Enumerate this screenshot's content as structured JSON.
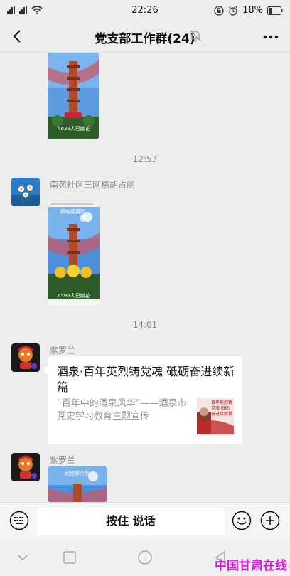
{
  "status_bar": {
    "time": "22:26",
    "battery": "18%",
    "network_left": "4G",
    "network_right": "4G"
  },
  "header": {
    "title": "党支部工作群(24)"
  },
  "messages": {
    "timestamp_1": "12:53",
    "timestamp_2": "14:01",
    "sender_1": "南苑社区三网格胡占丽",
    "sender_2": "紫罗兰",
    "sender_3": "紫罗兰",
    "poster_1_banner": "",
    "poster_2_banner": "网络祭英烈",
    "poster_3_banner": "网络祭英烈",
    "poster_count_1": "4639人已献花",
    "poster_count_2": "6599人已献花",
    "card": {
      "title": "酒泉·百年英烈铸党魂 砥砺奋进续新篇",
      "description": "“百年中的酒泉风华”——酒泉市党史学习教育主题宣传",
      "thumb_text": "百年英烈铸党魂 砥砺奋进续新篇"
    }
  },
  "input_bar": {
    "hold_to_talk": "按住 说话"
  },
  "watermark": "中国甘肃在线",
  "colors": {
    "background": "#ededed",
    "watermark": "#d11bd6",
    "bubble": "#ffffff"
  }
}
